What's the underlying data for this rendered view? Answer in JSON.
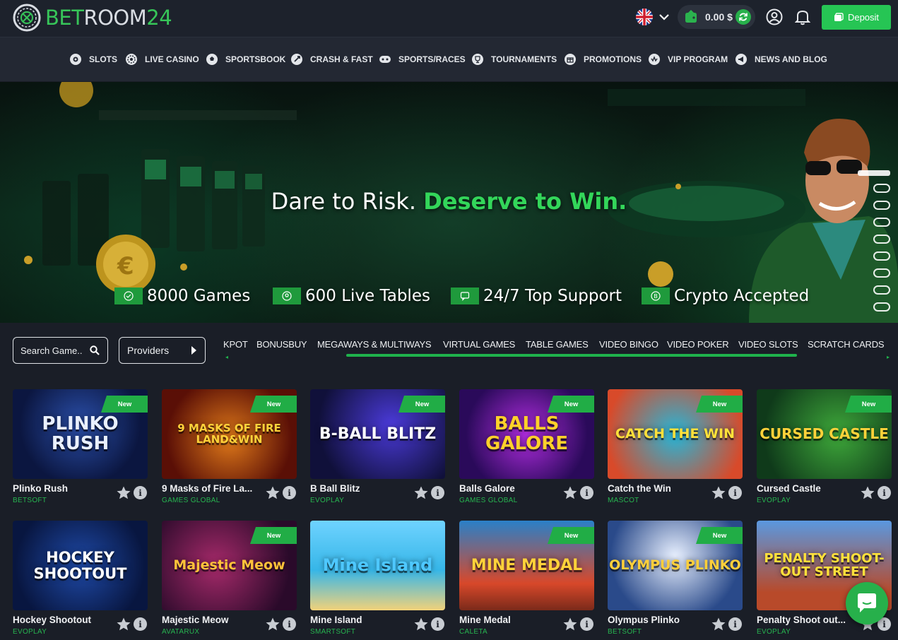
{
  "header": {
    "logo_text_a": "BET",
    "logo_text_b": "ROOM",
    "logo_text_c": "24",
    "balance": "0.00 $",
    "deposit_label": "Deposit",
    "icons": [
      "uk-flag-icon",
      "chevron-down-icon",
      "wallet-icon",
      "refresh-icon",
      "user-icon",
      "bell-icon",
      "deposit-icon"
    ]
  },
  "nav": [
    {
      "label": "SLOTS",
      "icon": "slots-icon"
    },
    {
      "label": "LIVE CASINO",
      "icon": "roulette-icon"
    },
    {
      "label": "SPORTSBOOK",
      "icon": "football-icon"
    },
    {
      "label": "CRASH & FAST",
      "icon": "rocket-icon"
    },
    {
      "label": "SPORTS/RACES",
      "icon": "gamepad-icon"
    },
    {
      "label": "TOURNAMENTS",
      "icon": "tournament-icon"
    },
    {
      "label": "PROMOTIONS",
      "icon": "gift-icon"
    },
    {
      "label": "VIP PROGRAM",
      "icon": "vip-icon"
    },
    {
      "label": "NEWS AND BLOG",
      "icon": "megaphone-icon"
    }
  ],
  "hero": {
    "title_plain": "Dare to Risk.",
    "title_highlight": "Deserve to Win.",
    "features": [
      "8000 Games",
      "600 Live Tables",
      "24/7 Top Support",
      "Crypto Accepted"
    ],
    "slide_count": 9,
    "active_slide": 1
  },
  "filters": {
    "search_label": "Search Game..",
    "providers_label": "Providers",
    "categories": [
      "KPOT",
      "BONUSBUY",
      "MEGAWAYS & MULTIWAYS",
      "VIRTUAL GAMES",
      "TABLE GAMES",
      "VIDEO BINGO",
      "VIDEO POKER",
      "VIDEO SLOTS",
      "SCRATCH CARDS"
    ]
  },
  "badge_label": "New",
  "games": [
    {
      "name": "Plinko Rush",
      "provider": "BETSOFT",
      "new": true,
      "art": "PLINKO RUSH"
    },
    {
      "name": "9 Masks of Fire La...",
      "provider": "GAMES GLOBAL",
      "new": true,
      "art": "9 MASKS OF FIRE LAND&WIN"
    },
    {
      "name": "B Ball Blitz",
      "provider": "EVOPLAY",
      "new": true,
      "art": "B-BALL BLITZ"
    },
    {
      "name": "Balls Galore",
      "provider": "GAMES GLOBAL",
      "new": true,
      "art": "BALLS GALORE"
    },
    {
      "name": "Catch the Win",
      "provider": "MASCOT",
      "new": true,
      "art": "CATCH THE WIN"
    },
    {
      "name": "Cursed Castle",
      "provider": "EVOPLAY",
      "new": true,
      "art": "CURSED CASTLE"
    },
    {
      "name": "Hockey Shootout",
      "provider": "EVOPLAY",
      "new": false,
      "art": "HOCKEY SHOOTOUT"
    },
    {
      "name": "Majestic Meow",
      "provider": "AVATARUX",
      "new": true,
      "art": "Majestic Meow"
    },
    {
      "name": "Mine Island",
      "provider": "SMARTSOFT",
      "new": false,
      "art": "Mine Island"
    },
    {
      "name": "Mine Medal",
      "provider": "CALETA",
      "new": true,
      "art": "MINE MEDAL"
    },
    {
      "name": "Olympus Plinko",
      "provider": "BETSOFT",
      "new": true,
      "art": "OLYMPUS PLINKO"
    },
    {
      "name": "Penalty Shoot out...",
      "provider": "EVOPLAY",
      "new": false,
      "art": "PENALTY SHOOT-OUT STREET"
    }
  ],
  "colors": {
    "accent": "#26c554",
    "bg": "#1a1e27",
    "nav_bg": "#232833"
  }
}
